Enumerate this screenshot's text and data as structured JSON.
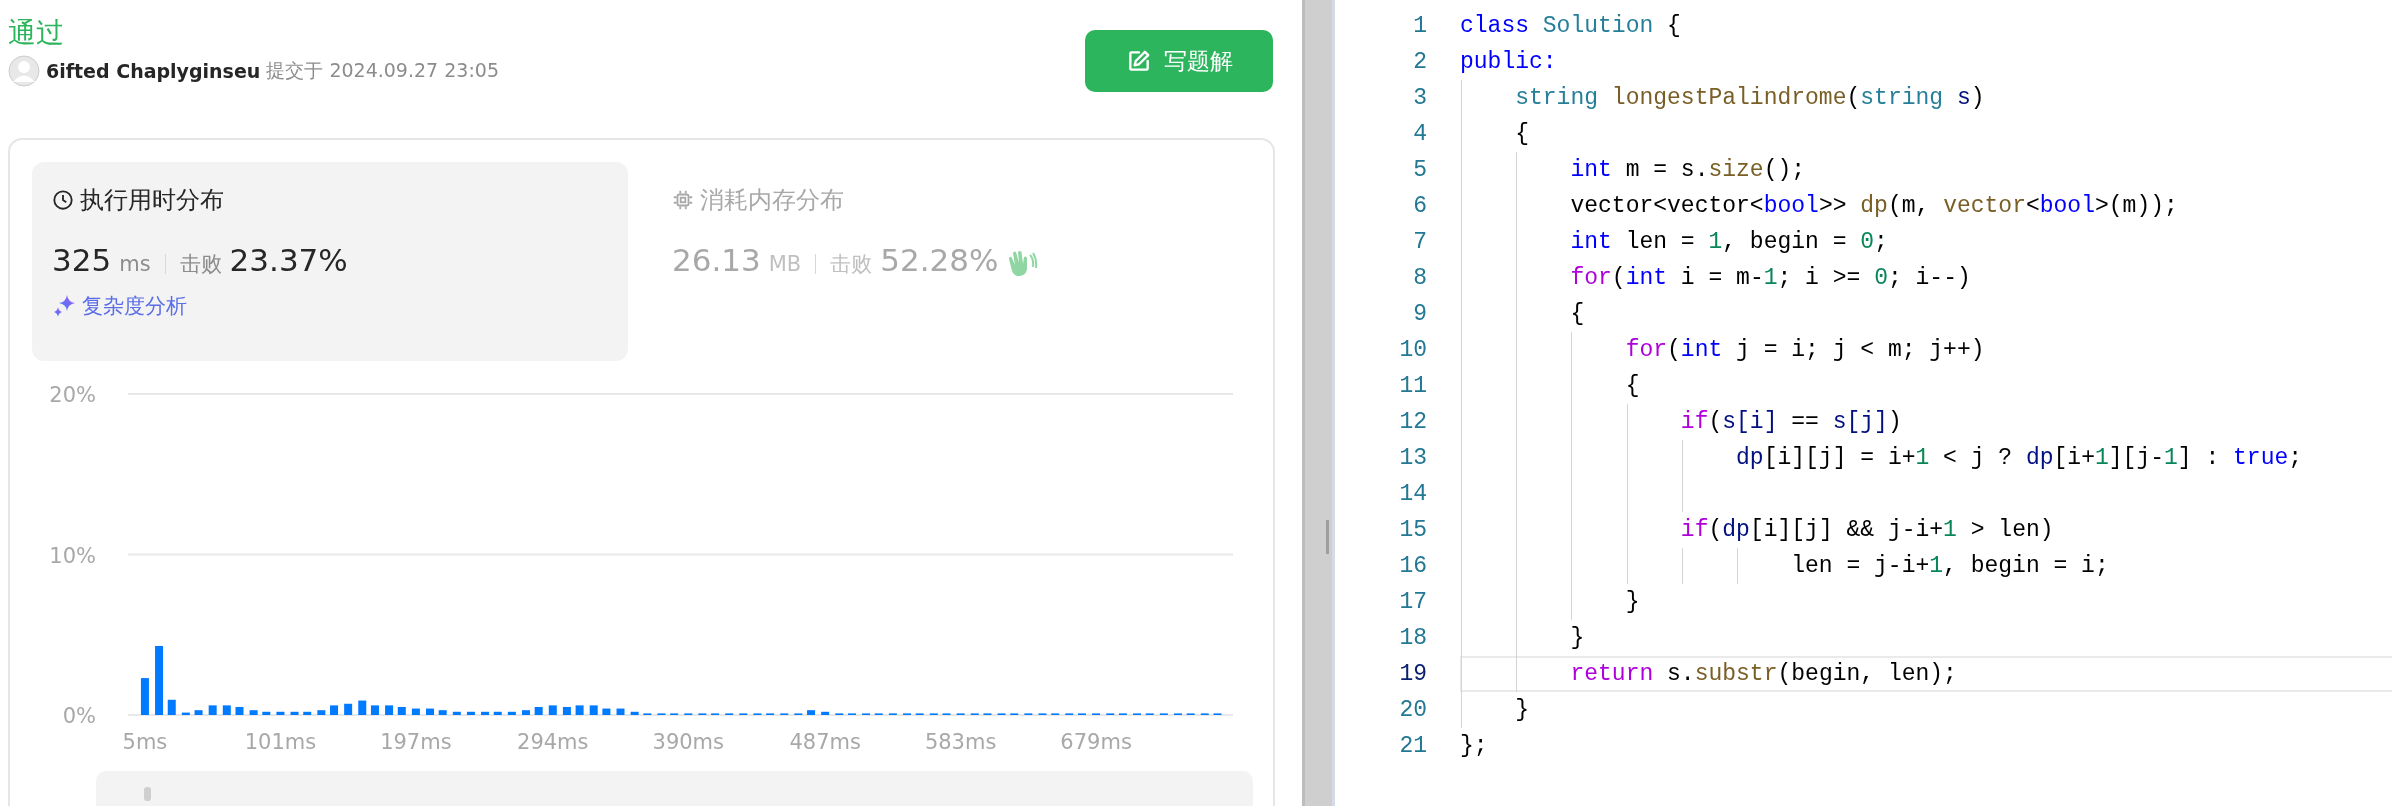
{
  "submission": {
    "status": "通过",
    "user": "6ifted Chaplyginseu",
    "submitted": "提交于 2024.09.27 23:05",
    "write_button": "写题解"
  },
  "stats": [
    {
      "kind": "runtime",
      "title": "执行用时分布",
      "selected": true,
      "value": "325",
      "unit": "ms",
      "beats_label": "击败",
      "beats": "23.37%",
      "link": "复杂度分析"
    },
    {
      "kind": "memory",
      "title": "消耗内存分布",
      "selected": false,
      "value": "26.13",
      "unit": "MB",
      "beats_label": "击败",
      "beats": "52.28%"
    }
  ],
  "chart_data": {
    "type": "bar",
    "xlim": [
      -7,
      776
    ],
    "ylim": [
      0,
      20
    ],
    "yticks": [
      {
        "value": 0,
        "label": "0%"
      },
      {
        "value": 10,
        "label": "10%"
      },
      {
        "value": 20,
        "label": "20%"
      }
    ],
    "xticks": [
      {
        "value": 5,
        "label": "5ms"
      },
      {
        "value": 101,
        "label": "101ms"
      },
      {
        "value": 197,
        "label": "197ms"
      },
      {
        "value": 294,
        "label": "294ms"
      },
      {
        "value": 390,
        "label": "390ms"
      },
      {
        "value": 487,
        "label": "487ms"
      },
      {
        "value": 583,
        "label": "583ms"
      },
      {
        "value": 679,
        "label": "679ms"
      }
    ],
    "x": [
      5,
      15,
      24,
      34,
      43,
      53,
      63,
      72,
      82,
      91,
      101,
      111,
      120,
      130,
      139,
      149,
      159,
      168,
      178,
      187,
      197,
      207,
      216,
      226,
      236,
      246,
      255,
      265,
      275,
      284,
      294,
      304,
      313,
      323,
      332,
      342,
      352,
      361,
      371,
      380,
      390,
      400,
      409,
      419,
      429,
      439,
      448,
      458,
      468,
      477,
      487,
      497,
      506,
      516,
      525,
      535,
      545,
      554,
      564,
      573,
      583,
      593,
      602,
      612,
      621,
      631,
      641,
      650,
      660,
      669,
      679,
      689,
      698,
      708,
      717,
      727,
      737,
      746,
      756,
      765
    ],
    "series": [
      {
        "color": "#007aff",
        "values": [
          2.3,
          4.3,
          0.95,
          0.15,
          0.3,
          0.6,
          0.6,
          0.5,
          0.3,
          0.2,
          0.2,
          0.2,
          0.2,
          0.3,
          0.6,
          0.7,
          0.9,
          0.6,
          0.6,
          0.5,
          0.4,
          0.4,
          0.3,
          0.2,
          0.2,
          0.2,
          0.2,
          0.2,
          0.3,
          0.5,
          0.6,
          0.5,
          0.6,
          0.6,
          0.4,
          0.4,
          0.2,
          0.1,
          0.1,
          0.1,
          0.1,
          0.1,
          0.1,
          0.1,
          0.1,
          0.1,
          0.1,
          0.1,
          0.1,
          0.3,
          0.2,
          0.1,
          0.1,
          0.1,
          0.1,
          0.1,
          0.1,
          0.1,
          0.1,
          0.1,
          0.1,
          0.1,
          0.1,
          0.1,
          0.1,
          0.1,
          0.1,
          0.1,
          0.1,
          0.1,
          0.1,
          0.1,
          0.1,
          0.1,
          0.1,
          0.1,
          0.1,
          0.1,
          0.1,
          0.1
        ]
      }
    ]
  },
  "code": [
    {
      "number": "1",
      "current": false,
      "tokens": [
        {
          "kind": "kw",
          "text": "class"
        },
        {
          "kind": "type",
          "text": " Solution"
        },
        {
          "kind": "p",
          "text": " {"
        }
      ]
    },
    {
      "number": "2",
      "current": false,
      "tokens": [
        {
          "kind": "kw",
          "text": "public:"
        }
      ]
    },
    {
      "number": "3",
      "current": false,
      "tokens": [
        {
          "kind": "type",
          "text": "    string"
        },
        {
          "kind": "fn",
          "text": " longestPalindrome"
        },
        {
          "kind": "p",
          "text": "("
        },
        {
          "kind": "type",
          "text": "string"
        },
        {
          "kind": "var",
          "text": " s"
        },
        {
          "kind": "p",
          "text": ")"
        }
      ]
    },
    {
      "number": "4",
      "current": false,
      "tokens": [
        {
          "kind": "p",
          "text": "    {"
        }
      ]
    },
    {
      "number": "5",
      "current": false,
      "tokens": [
        {
          "kind": "kw",
          "text": "        int"
        },
        {
          "kind": "p",
          "text": " m = s."
        },
        {
          "kind": "fn",
          "text": "size"
        },
        {
          "kind": "p",
          "text": "();"
        }
      ]
    },
    {
      "number": "6",
      "current": false,
      "tokens": [
        {
          "kind": "p",
          "text": "        vector<vector<"
        },
        {
          "kind": "kw",
          "text": "bool"
        },
        {
          "kind": "p",
          "text": ">>"
        },
        {
          "kind": "fn",
          "text": " dp"
        },
        {
          "kind": "p",
          "text": "(m,"
        },
        {
          "kind": "fn",
          "text": " vector"
        },
        {
          "kind": "p",
          "text": "<"
        },
        {
          "kind": "kw",
          "text": "bool"
        },
        {
          "kind": "p",
          "text": ">(m));"
        }
      ]
    },
    {
      "number": "7",
      "current": false,
      "tokens": [
        {
          "kind": "kw",
          "text": "        int"
        },
        {
          "kind": "p",
          "text": " len = "
        },
        {
          "kind": "num",
          "text": "1"
        },
        {
          "kind": "p",
          "text": ", begin = "
        },
        {
          "kind": "num",
          "text": "0"
        },
        {
          "kind": "p",
          "text": ";"
        }
      ]
    },
    {
      "number": "8",
      "current": false,
      "tokens": [
        {
          "kind": "ctl",
          "text": "        for"
        },
        {
          "kind": "p",
          "text": "("
        },
        {
          "kind": "kw",
          "text": "int"
        },
        {
          "kind": "p",
          "text": " i = m-"
        },
        {
          "kind": "num",
          "text": "1"
        },
        {
          "kind": "p",
          "text": "; i >= "
        },
        {
          "kind": "num",
          "text": "0"
        },
        {
          "kind": "p",
          "text": "; i--)"
        }
      ]
    },
    {
      "number": "9",
      "current": false,
      "tokens": [
        {
          "kind": "p",
          "text": "        {"
        }
      ]
    },
    {
      "number": "10",
      "current": false,
      "tokens": [
        {
          "kind": "ctl",
          "text": "            for"
        },
        {
          "kind": "p",
          "text": "("
        },
        {
          "kind": "kw",
          "text": "int"
        },
        {
          "kind": "p",
          "text": " j = i; j < m; j++)"
        }
      ]
    },
    {
      "number": "11",
      "current": false,
      "tokens": [
        {
          "kind": "p",
          "text": "            {"
        }
      ]
    },
    {
      "number": "12",
      "current": false,
      "tokens": [
        {
          "kind": "ctl",
          "text": "                if"
        },
        {
          "kind": "p",
          "text": "("
        },
        {
          "kind": "var",
          "text": "s[i]"
        },
        {
          "kind": "p",
          "text": " =="
        },
        {
          "kind": "var",
          "text": " s[j]"
        },
        {
          "kind": "p",
          "text": ")"
        }
      ]
    },
    {
      "number": "13",
      "current": false,
      "tokens": [
        {
          "kind": "var",
          "text": "                    dp"
        },
        {
          "kind": "p",
          "text": "[i][j] = i+"
        },
        {
          "kind": "num",
          "text": "1"
        },
        {
          "kind": "p",
          "text": " < j ?"
        },
        {
          "kind": "var",
          "text": " dp"
        },
        {
          "kind": "p",
          "text": "[i+"
        },
        {
          "kind": "num",
          "text": "1"
        },
        {
          "kind": "p",
          "text": "][j-"
        },
        {
          "kind": "num",
          "text": "1"
        },
        {
          "kind": "p",
          "text": "] :"
        },
        {
          "kind": "kw",
          "text": " true"
        },
        {
          "kind": "p",
          "text": ";"
        }
      ]
    },
    {
      "number": "14",
      "current": false
    },
    {
      "number": "15",
      "current": false,
      "tokens": [
        {
          "kind": "ctl",
          "text": "                if"
        },
        {
          "kind": "p",
          "text": "("
        },
        {
          "kind": "var",
          "text": "dp"
        },
        {
          "kind": "p",
          "text": "[i][j] && j-i+"
        },
        {
          "kind": "num",
          "text": "1"
        },
        {
          "kind": "p",
          "text": " > len)"
        }
      ]
    },
    {
      "number": "16",
      "current": false,
      "tokens": [
        {
          "kind": "p",
          "text": "                        len = j-i+"
        },
        {
          "kind": "num",
          "text": "1"
        },
        {
          "kind": "p",
          "text": ", begin = i;"
        }
      ]
    },
    {
      "number": "17",
      "current": false,
      "tokens": [
        {
          "kind": "p",
          "text": "            }"
        }
      ]
    },
    {
      "number": "18",
      "current": false,
      "tokens": [
        {
          "kind": "p",
          "text": "        }"
        }
      ]
    },
    {
      "number": "19",
      "current": true,
      "tokens": [
        {
          "kind": "ctl",
          "text": "        return"
        },
        {
          "kind": "p",
          "text": " s."
        },
        {
          "kind": "fn",
          "text": "substr"
        },
        {
          "kind": "p",
          "text": "(begin, len);"
        }
      ]
    },
    {
      "number": "20",
      "current": false,
      "tokens": [
        {
          "kind": "p",
          "text": "    }"
        }
      ]
    },
    {
      "number": "21",
      "current": false,
      "tokens": [
        {
          "kind": "p",
          "text": "};"
        }
      ]
    }
  ]
}
